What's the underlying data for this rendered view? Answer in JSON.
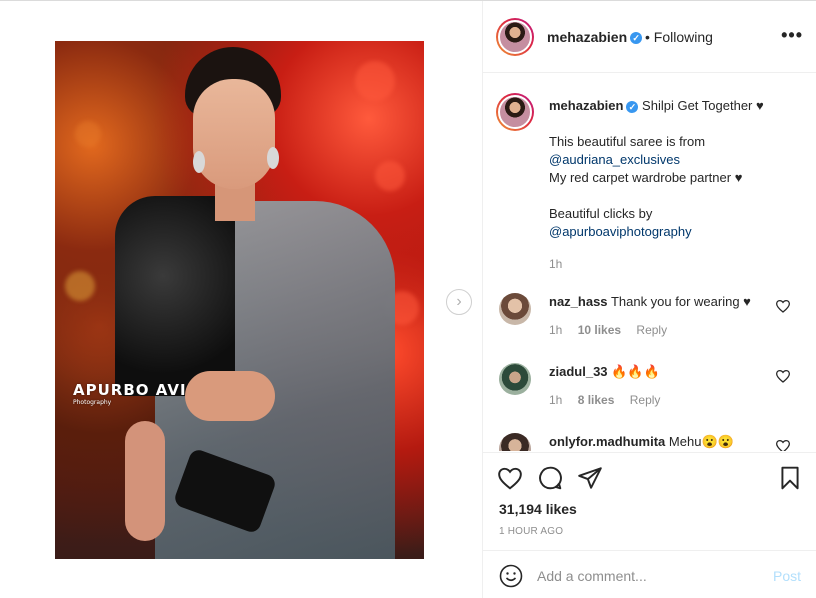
{
  "post": {
    "author": {
      "username": "mehazabien",
      "verified_icon": "verified-badge-icon",
      "follow_status": "• Following"
    },
    "photo": {
      "watermark_title": "APURBO AVI",
      "watermark_sub": "Photography"
    },
    "caption": {
      "username": "mehazabien",
      "first_line": "Shilpi Get Together ♥",
      "line2": "This beautiful saree is from",
      "mention1": "@audriana_exclusives",
      "line3": "My red carpet wardrobe partner ♥",
      "line4": "Beautiful clicks by",
      "mention2": "@apurboaviphotography",
      "time": "1h"
    },
    "comments": [
      {
        "username": "naz_hass",
        "text": "Thank you for wearing ♥",
        "time": "1h",
        "likes": "10 likes",
        "reply": "Reply"
      },
      {
        "username": "ziadul_33",
        "text": "🔥🔥🔥",
        "time": "1h",
        "likes": "8 likes",
        "reply": "Reply"
      },
      {
        "username": "onlyfor.madhumita",
        "text": "Mehu😮😮",
        "time": "",
        "likes": "",
        "reply": ""
      }
    ],
    "stats": {
      "likes": "31,194 likes",
      "posted": "1 HOUR AGO"
    },
    "add_comment": {
      "placeholder": "Add a comment...",
      "post_label": "Post"
    },
    "icons": {
      "like": "heart-icon",
      "comment": "comment-icon",
      "share": "paper-plane-icon",
      "save": "bookmark-icon",
      "more": "ellipsis-icon",
      "next": "chevron-right-icon",
      "emoji": "smiley-icon"
    },
    "colors": {
      "link": "#00376b",
      "verified": "#3897f0",
      "muted": "#8e8e8e",
      "post_button": "#b2dffc"
    }
  }
}
